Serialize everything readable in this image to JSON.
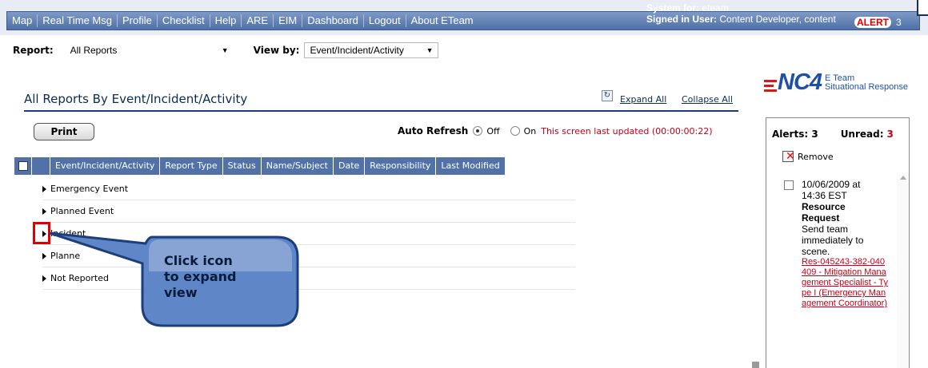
{
  "nav": {
    "items": [
      "Map",
      "Real Time Msg",
      "Profile",
      "Checklist",
      "Help",
      "ARE",
      "EIM",
      "Dashboard",
      "Logout",
      "About ETeam"
    ],
    "system_label": "System for:",
    "system_value": "eteam",
    "user_label": "Signed in User:",
    "user_value": "Content Developer, content",
    "alert_badge": "ALERT",
    "alert_count": "3"
  },
  "filters": {
    "report_label": "Report:",
    "report_value": "All Reports",
    "viewby_label": "View by:",
    "viewby_value": "Event/Incident/Activity"
  },
  "heading": {
    "title": "All Reports By Event/Incident/Activity",
    "expand_all": "Expand All",
    "collapse_all": "Collapse All"
  },
  "toolbar": {
    "print_label": "Print",
    "auto_refresh_label": "Auto Refresh",
    "off_label": "Off",
    "on_label": "On",
    "auto_refresh_selected": "Off",
    "last_updated": "This screen last updated (00:00:00:22)"
  },
  "grid": {
    "columns": [
      "Event/Incident/Activity",
      "Report Type",
      "Status",
      "Name/Subject",
      "Date",
      "Responsibility",
      "Last Modified"
    ],
    "rows": [
      "Emergency Event",
      "Planned Event",
      "Incident",
      "Planned Activity",
      "Not Reported"
    ],
    "row4_visible": "Planne"
  },
  "callout": {
    "line1": "Click icon",
    "line2": "to expand",
    "line3": "view",
    "fill": "#5f86c6"
  },
  "logo": {
    "mark": "NC4",
    "line1": "E Team",
    "line2": "Situational Response"
  },
  "alerts": {
    "alerts_label": "Alerts:",
    "alerts_count": "3",
    "unread_label": "Unread:",
    "unread_count": "3",
    "remove_label": "Remove",
    "item": {
      "date": "10/06/2009 at",
      "time": "14:36 EST",
      "title_line1": "Resource",
      "title_line2": "Request",
      "message": "Send team immediately to scene.",
      "link": "Res-045243-382-040409 - Mitigation Management Specialist - Type I (Emergency Management Coordinator)"
    }
  },
  "colors": {
    "nav_bar": "#5b7bb2",
    "grid_header": "#5271a7",
    "accent_red": "#c4001a",
    "title_blue": "#0c2a55"
  }
}
